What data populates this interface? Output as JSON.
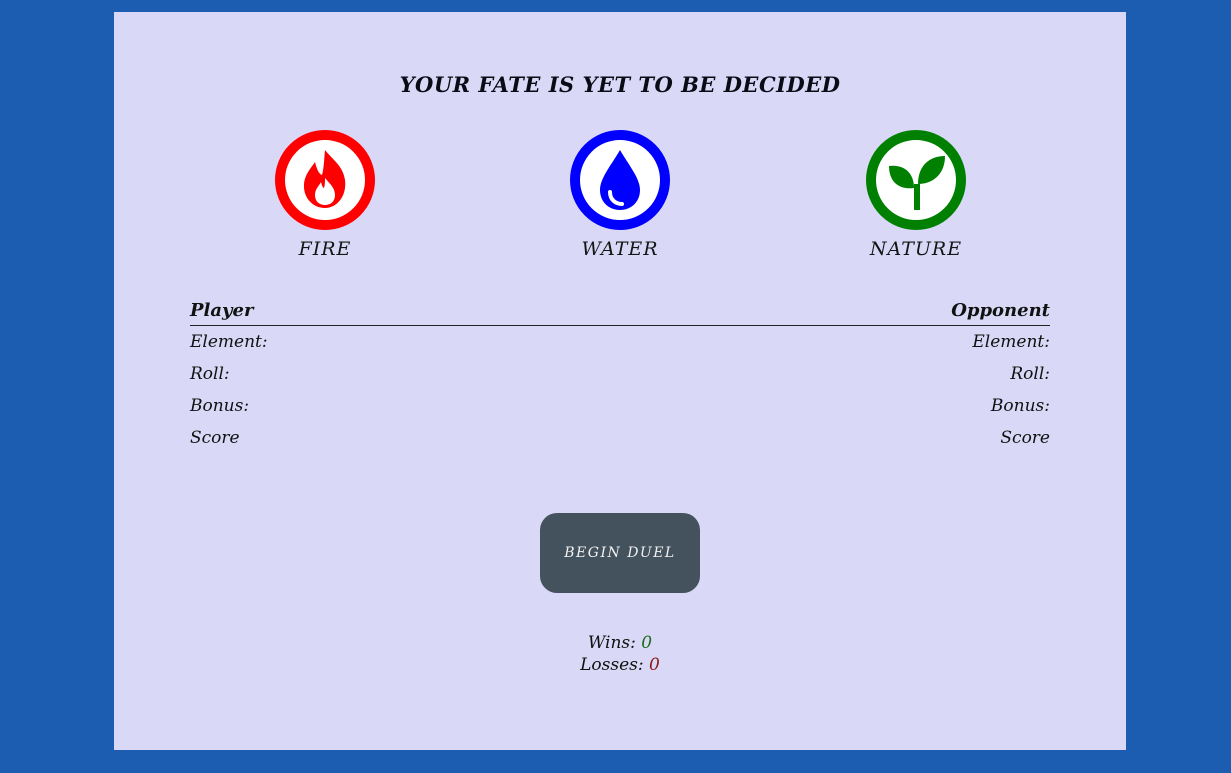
{
  "header": {
    "title": "YOUR FATE IS YET TO BE DECIDED"
  },
  "elements": [
    {
      "label": "FIRE",
      "icon": "flame-icon",
      "color": "#ff0000"
    },
    {
      "label": "WATER",
      "icon": "water-drop-icon",
      "color": "#0000ff"
    },
    {
      "label": "NATURE",
      "icon": "sprout-icon",
      "color": "#008000"
    }
  ],
  "stats": {
    "player_heading": "Player",
    "opponent_heading": "Opponent",
    "player_rows": [
      "Element:",
      "Roll:",
      "Bonus:",
      "Score"
    ],
    "opponent_rows": [
      "Element:",
      "Roll:",
      "Bonus:",
      "Score"
    ]
  },
  "action": {
    "duel_label": "BEGIN DUEL"
  },
  "record": {
    "wins_label": "Wins:",
    "wins_value": "0",
    "losses_label": "Losses:",
    "losses_value": "0"
  },
  "colors": {
    "background": "#1c5db1",
    "panel": "#d9d9f7",
    "button": "#44525e"
  }
}
